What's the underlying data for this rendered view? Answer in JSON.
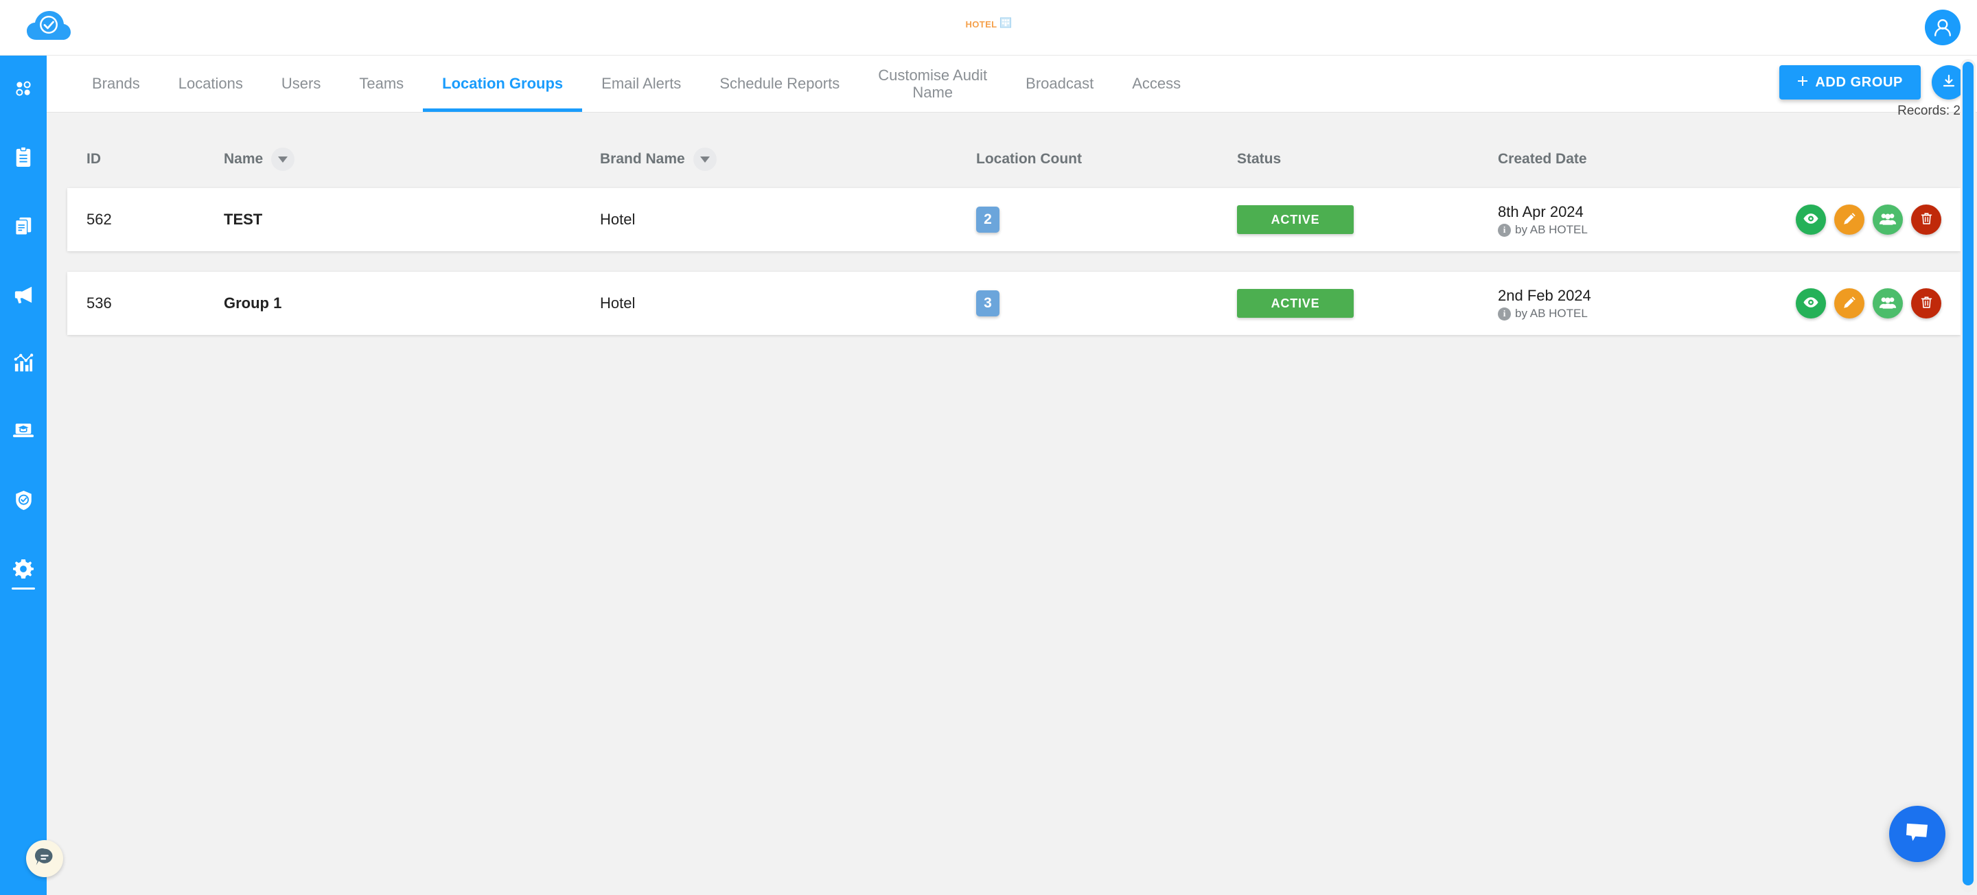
{
  "app": {
    "logo_icon": "cloud-check-icon",
    "center_logo_text": "HOTEL",
    "center_logo_icon": "building-icon",
    "avatar_icon": "user-avatar-icon",
    "accent_color": "#1a9cfc"
  },
  "sidebar": {
    "items": [
      {
        "icon": "dashboard-dots-icon",
        "active": false
      },
      {
        "icon": "clipboard-icon",
        "active": false
      },
      {
        "icon": "documents-icon",
        "active": false
      },
      {
        "icon": "megaphone-icon",
        "active": false
      },
      {
        "icon": "analytics-chart-icon",
        "active": false
      },
      {
        "icon": "elearning-laptop-icon",
        "active": false
      },
      {
        "icon": "shield-check-icon",
        "active": false
      },
      {
        "icon": "gear-icon",
        "active": true
      }
    ]
  },
  "tabs": [
    {
      "label": "Brands",
      "active": false
    },
    {
      "label": "Locations",
      "active": false
    },
    {
      "label": "Users",
      "active": false
    },
    {
      "label": "Teams",
      "active": false
    },
    {
      "label": "Location Groups",
      "active": true
    },
    {
      "label": "Email Alerts",
      "active": false
    },
    {
      "label": "Schedule Reports",
      "active": false
    },
    {
      "label": "Customise Audit\nName",
      "active": false
    },
    {
      "label": "Broadcast",
      "active": false
    },
    {
      "label": "Access",
      "active": false
    }
  ],
  "toolbar": {
    "add_label": "ADD GROUP",
    "add_icon": "plus-icon",
    "download_icon": "download-icon",
    "records_label": "Records: 2"
  },
  "table": {
    "columns": [
      {
        "label": "ID",
        "filter": false
      },
      {
        "label": "Name",
        "filter": true
      },
      {
        "label": "Brand Name",
        "filter": true
      },
      {
        "label": "Location Count",
        "filter": false
      },
      {
        "label": "Status",
        "filter": false
      },
      {
        "label": "Created Date",
        "filter": false
      }
    ],
    "rows": [
      {
        "id": "562",
        "name": "TEST",
        "brand": "Hotel",
        "count": "2",
        "status": "ACTIVE",
        "date": "8th Apr 2024",
        "by": "by AB HOTEL"
      },
      {
        "id": "536",
        "name": "Group 1",
        "brand": "Hotel",
        "count": "3",
        "status": "ACTIVE",
        "date": "2nd Feb 2024",
        "by": "by AB HOTEL"
      }
    ],
    "actions": [
      {
        "name": "view",
        "icon": "eye-icon",
        "color": "#25b158"
      },
      {
        "name": "edit",
        "icon": "pencil-icon",
        "color": "#ef9b21"
      },
      {
        "name": "manage-locations",
        "icon": "users-group-icon",
        "color": "#4cbd6b"
      },
      {
        "name": "delete",
        "icon": "trash-icon",
        "color": "#c0290a"
      }
    ]
  },
  "widgets": {
    "chat_icon": "chat-bubble-icon",
    "help_icon": "help-chat-icon"
  }
}
